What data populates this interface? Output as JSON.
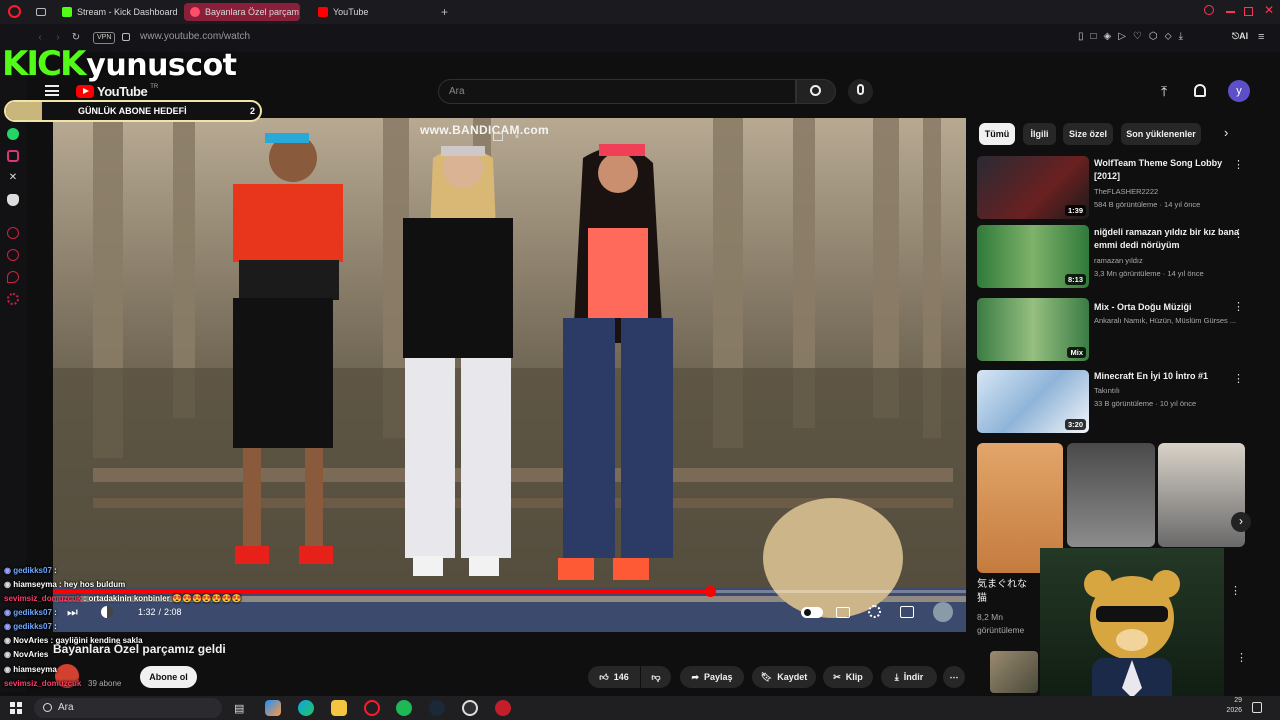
{
  "browser": {
    "tabs": [
      {
        "label": "Stream - Kick Dashboard"
      },
      {
        "label": "Bayanlara Özel parçam"
      },
      {
        "label": "YouTube"
      }
    ],
    "address": "www.youtube.com/watch",
    "vpn": "VPN",
    "ai_label": "AI"
  },
  "overlay": {
    "kick_logo": "KICK",
    "channel_name": "yunuscot",
    "goal_label": "GÜNLÜK ABONE HEDEFİ",
    "goal_count": "2",
    "watermark": "www.BANDICAM.com"
  },
  "youtube": {
    "logo_text": "YouTube",
    "logo_region": "TR",
    "search_placeholder": "Ara",
    "avatar_letter": "y",
    "video_title": "Bayanlara Özel parçamız geldi",
    "time_current": "1:32",
    "time_total": "2:08",
    "time_separator": "/",
    "progress": 0.72,
    "subscribe_label": "Abone ol",
    "channel_subs": "39 abone",
    "like_count": "146",
    "share_label": "Paylaş",
    "save_label": "Kaydet",
    "clip_label": "Klip",
    "download_label": "İndir",
    "chips": [
      "Tümü",
      "İlgili",
      "Size özel",
      "Son yüklenenler"
    ],
    "recommendations": [
      {
        "title": "WolfTeam Theme Song Lobby [2012]",
        "channel": "TheFLASHER2222",
        "stats": "584 B görüntüleme · 14 yıl önce",
        "duration": "1:39"
      },
      {
        "title": "niğdeli ramazan yıldız bir kız bana emmi dedi nörüyüm",
        "channel": "ramazan yıldız",
        "stats": "3,3 Mn görüntüleme · 14 yıl önce",
        "duration": "8:13"
      },
      {
        "title": "Mix - Orta Doğu Müziği",
        "channel": "Ankaralı Namık, Hüzün, Müslüm Gürses ...",
        "stats": "",
        "duration": "Mix"
      },
      {
        "title": "Minecraft En İyi 10 İntro #1",
        "channel": "Takıntılı",
        "stats": "33 B görüntüleme · 10 yıl önce",
        "duration": "3:20"
      }
    ],
    "short_title": "気まぐれな猫",
    "short_views": "8,2 Mn görüntüleme"
  },
  "chat": [
    {
      "user": "gedikks07",
      "text": ""
    },
    {
      "user": "hiamseyma",
      "text": "hey hos buldum"
    },
    {
      "user": "sevimsiz_domuzcuk",
      "text": "ortadakinin konbinler 😍😍😍😍😍😍😍"
    },
    {
      "user": "gedikks07",
      "text": ""
    },
    {
      "user": "gedikks07",
      "text": ""
    },
    {
      "user": "NovAries",
      "text": "gayliğini kendine sakla"
    },
    {
      "user": "NovAries",
      "text": ""
    },
    {
      "user": "hiamseyma",
      "text": ""
    },
    {
      "user": "sevimsiz_domuzcuk",
      "text": ""
    }
  ],
  "taskbar": {
    "search_label": "Ara",
    "clock_time": "29",
    "clock_year": "2026"
  },
  "colors": {
    "kick_green": "#53fc18",
    "yt_red": "#ff0000",
    "opera_red": "#ff1b2d",
    "bg": "#0f0f0f"
  }
}
